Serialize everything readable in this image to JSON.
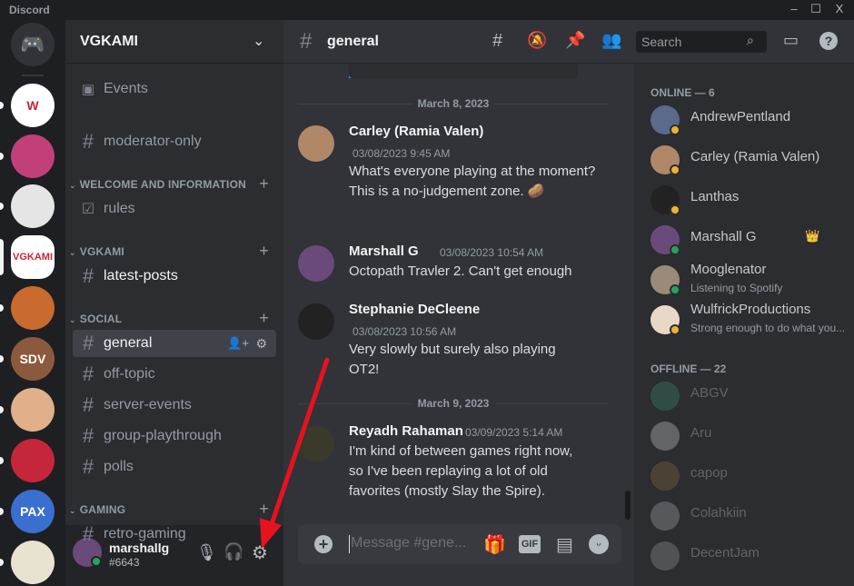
{
  "window": {
    "title": "Discord",
    "controls": [
      "–",
      "☐",
      "X"
    ]
  },
  "servers": [
    {
      "name": "home",
      "label": "",
      "color": "#313338"
    },
    {
      "name": "w",
      "label": "W",
      "color": "#ffffff"
    },
    {
      "name": "pixel",
      "label": "",
      "color": "#c2407a"
    },
    {
      "name": "steam",
      "label": "",
      "color": "#e5e5e5"
    },
    {
      "name": "vgkami",
      "label": "VGKAMI",
      "color": "#ffffff"
    },
    {
      "name": "reddit",
      "label": "",
      "color": "#c96a2e"
    },
    {
      "name": "sdv",
      "label": "SDV",
      "color": "#8b5a3c"
    },
    {
      "name": "cat",
      "label": "",
      "color": "#e0b08a"
    },
    {
      "name": "red",
      "label": "",
      "color": "#c6263a"
    },
    {
      "name": "pax",
      "label": "PAX",
      "color": "#3a6fd0"
    },
    {
      "name": "shield",
      "label": "",
      "color": "#e8e2d0"
    }
  ],
  "sidebar": {
    "server_name": "VGKAMI",
    "events": "Events",
    "items": [
      {
        "type": "channel",
        "label": "moderator-only"
      },
      {
        "type": "category",
        "label": "WELCOME AND INFORMATION"
      },
      {
        "type": "channel",
        "label": "rules"
      },
      {
        "type": "category",
        "label": "VGKAMI"
      },
      {
        "type": "channel",
        "label": "latest-posts"
      },
      {
        "type": "category",
        "label": "SOCIAL"
      },
      {
        "type": "channel",
        "label": "general"
      },
      {
        "type": "channel",
        "label": "off-topic"
      },
      {
        "type": "channel",
        "label": "server-events"
      },
      {
        "type": "channel",
        "label": "group-playthrough"
      },
      {
        "type": "channel",
        "label": "polls"
      },
      {
        "type": "category",
        "label": "GAMING"
      },
      {
        "type": "channel",
        "label": "retro-gaming"
      }
    ],
    "user": {
      "name": "marshallg",
      "tag": "#6643"
    }
  },
  "header": {
    "channel": "general",
    "search_placeholder": "Search"
  },
  "chat": {
    "dividers": [
      "March 8, 2023",
      "March 9, 2023"
    ],
    "messages": [
      {
        "author": "Carley (Ramia Valen)",
        "time": "03/08/2023 9:45 AM",
        "text": "What's everyone playing at the moment? This is a no-judgement zone. 🥔"
      },
      {
        "author": "Marshall G",
        "time": "03/08/2023 10:54 AM",
        "text": "Octopath Travler 2. Can't get enough"
      },
      {
        "author": "Stephanie DeCleene",
        "time": "03/08/2023 10:56 AM",
        "text": "Very slowly but surely also playing OT2!"
      },
      {
        "author": "Reyadh Rahaman",
        "time": "03/09/2023 5:14 AM",
        "text": "I'm kind of between games right now, so I've been replaying a lot of old favorites (mostly Slay the Spire)."
      }
    ],
    "composer_placeholder": "Message #gene...",
    "gif_label": "GIF"
  },
  "members": {
    "online_header": "ONLINE — 6",
    "online": [
      {
        "name": "AndrewPentland",
        "status": "",
        "color": "#5a6a8a"
      },
      {
        "name": "Carley (Ramia Valen)",
        "status": "",
        "color": "#b08868"
      },
      {
        "name": "Lanthas",
        "status": "",
        "color": "#222222"
      },
      {
        "name": "Marshall G",
        "status": "",
        "color": "#6a4a7a",
        "badge": "👑"
      },
      {
        "name": "Mooglenator",
        "status": "Listening to Spotify",
        "color": "#9a8a7a"
      },
      {
        "name": "WulfrickProductions",
        "status": "Strong enough to do what you...",
        "color": "#e8d8c8"
      }
    ],
    "offline_header": "OFFLINE — 22",
    "offline": [
      {
        "name": "ABGV",
        "color": "#3a8a6a"
      },
      {
        "name": "Aru",
        "color": "#cccccc"
      },
      {
        "name": "capop",
        "color": "#8a6a3a"
      },
      {
        "name": "Colahkiin",
        "color": "#aaaaaa"
      },
      {
        "name": "DecentJam",
        "color": "#999999"
      }
    ]
  }
}
